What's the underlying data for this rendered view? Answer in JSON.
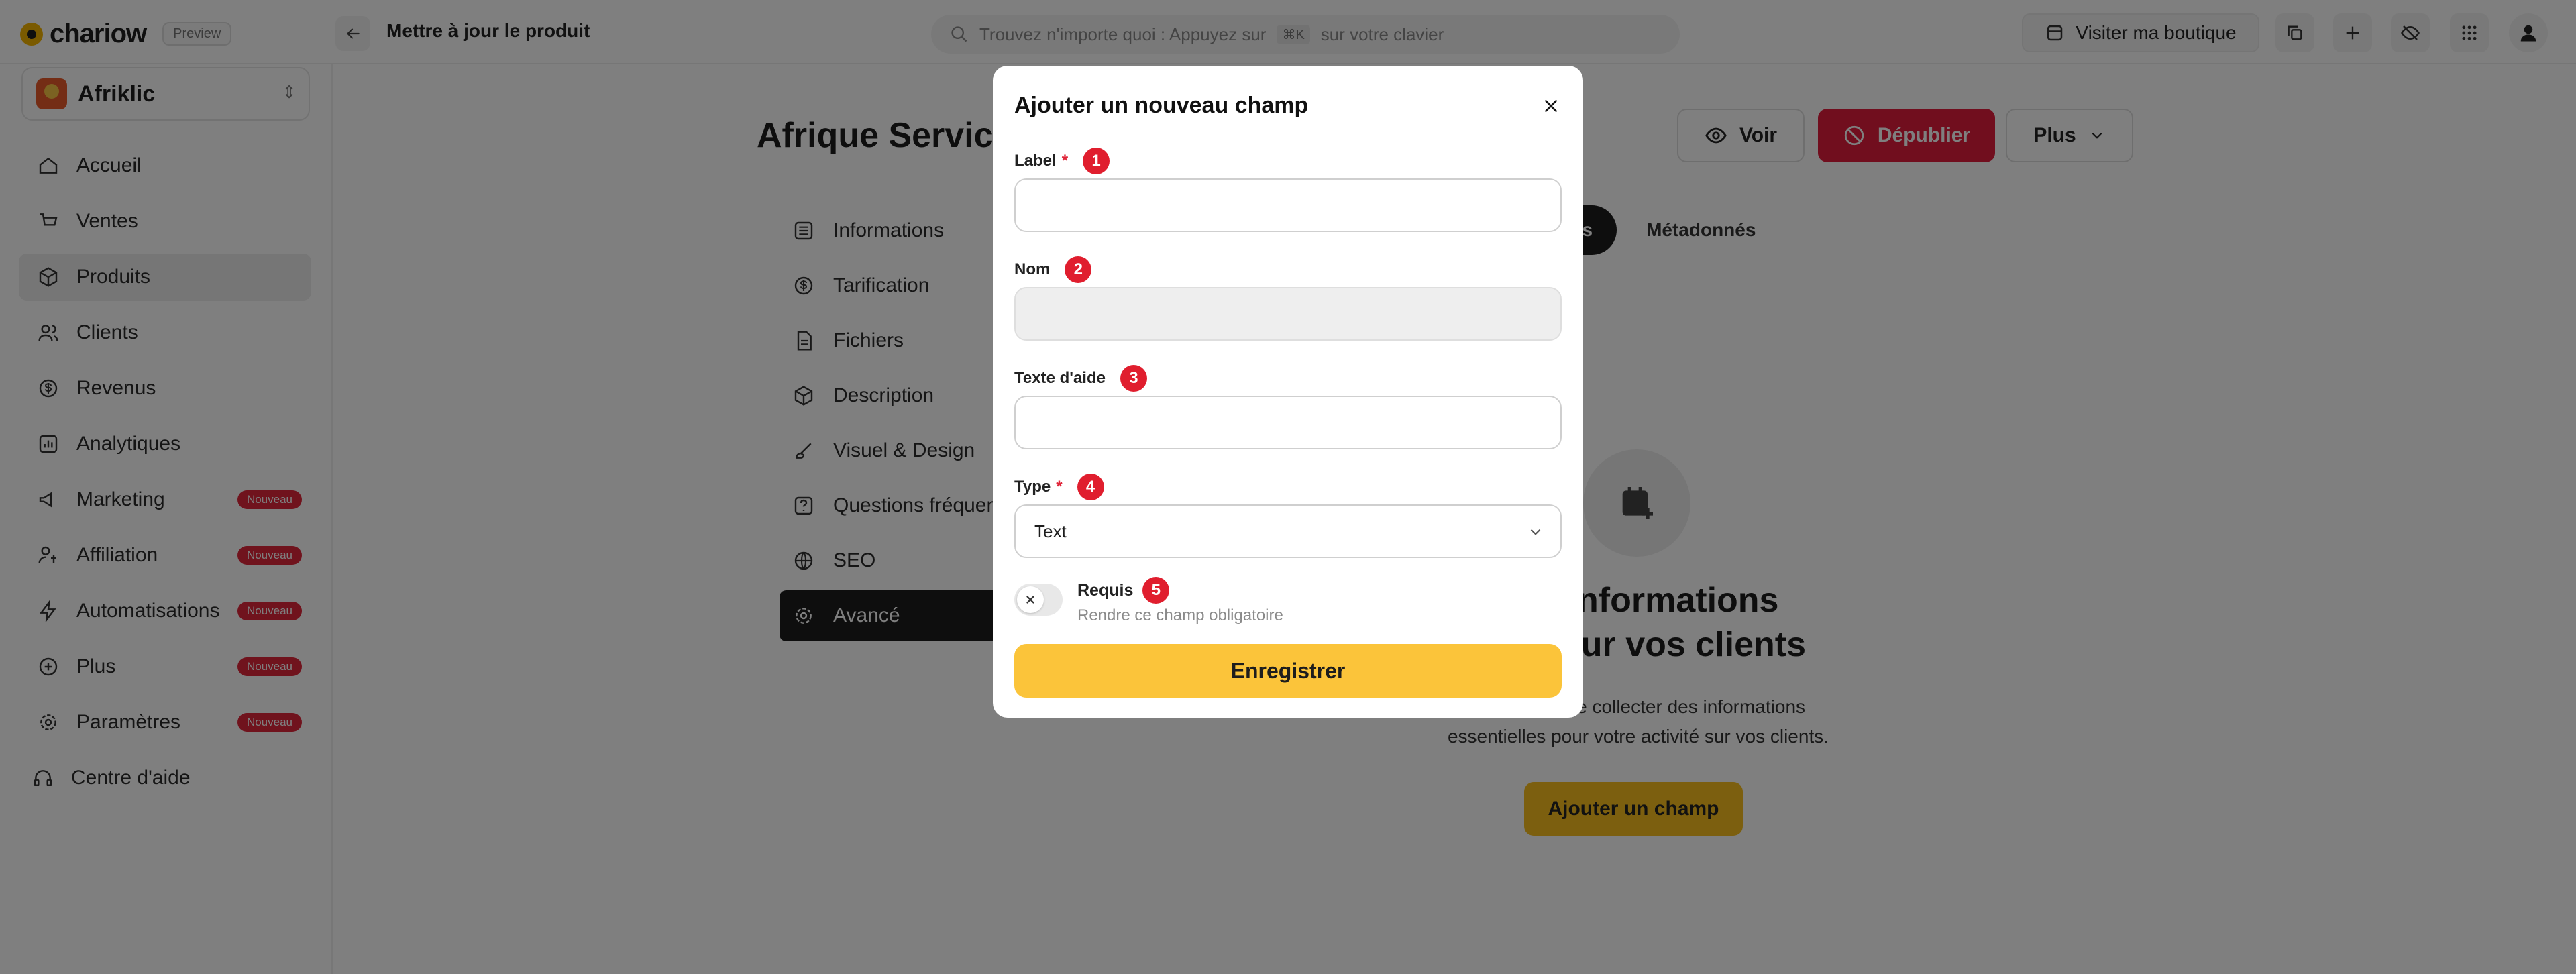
{
  "topbar": {
    "logo_text": "chariow",
    "preview_badge": "Preview",
    "page_heading": "Mettre à jour le produit",
    "search_placeholder": "Trouvez n'importe quoi : Appuyez sur",
    "search_shortcut": "⌘K",
    "search_suffix": "sur votre clavier",
    "visit_label": "Visiter ma boutique"
  },
  "sidebar": {
    "store_name": "Afriklic",
    "items": [
      {
        "label": "Accueil",
        "icon": "home-icon",
        "badge": ""
      },
      {
        "label": "Ventes",
        "icon": "cart-icon",
        "badge": ""
      },
      {
        "label": "Produits",
        "icon": "box-icon",
        "badge": "",
        "active": true
      },
      {
        "label": "Clients",
        "icon": "users-icon",
        "badge": ""
      },
      {
        "label": "Revenus",
        "icon": "money-icon",
        "badge": ""
      },
      {
        "label": "Analytiques",
        "icon": "chart-icon",
        "badge": ""
      },
      {
        "label": "Marketing",
        "icon": "megaphone-icon",
        "badge": "Nouveau"
      },
      {
        "label": "Affiliation",
        "icon": "affiliate-icon",
        "badge": "Nouveau"
      },
      {
        "label": "Automatisations",
        "icon": "bolt-icon",
        "badge": "Nouveau"
      },
      {
        "label": "Plus",
        "icon": "plus-circle-icon",
        "badge": "Nouveau"
      },
      {
        "label": "Paramètres",
        "icon": "gear-icon",
        "badge": "Nouveau"
      },
      {
        "label": "Centre d'aide",
        "icon": "headset-icon",
        "badge": ""
      }
    ]
  },
  "main": {
    "product_title": "Afrique Service",
    "voir_label": "Voir",
    "depublier_label": "Dépublier",
    "plus_label": "Plus",
    "submenu": [
      {
        "label": "Informations",
        "icon": "list-icon"
      },
      {
        "label": "Tarification",
        "icon": "dollar-icon"
      },
      {
        "label": "Fichiers",
        "icon": "file-icon"
      },
      {
        "label": "Description",
        "icon": "cube-icon"
      },
      {
        "label": "Visuel & Design",
        "icon": "brush-icon"
      },
      {
        "label": "Questions fréquen",
        "icon": "question-icon"
      },
      {
        "label": "SEO",
        "icon": "globe-icon"
      },
      {
        "label": "Avancé",
        "icon": "settings-icon",
        "active": true
      }
    ],
    "tabs": [
      "nnalisés",
      "Métadonnés"
    ],
    "empty_title_line1": "des informations",
    "empty_title_line2": "aires sur vos clients",
    "empty_desc": "permettent de collecter des informations essentielles pour votre activité sur vos clients.",
    "empty_cta": "Ajouter un champ"
  },
  "modal": {
    "title": "Ajouter un nouveau champ",
    "fields": {
      "label": {
        "label": "Label",
        "required": "*",
        "marker": "1",
        "value": ""
      },
      "nom": {
        "label": "Nom",
        "marker": "2",
        "value": ""
      },
      "help": {
        "label": "Texte d'aide",
        "marker": "3",
        "value": ""
      },
      "type": {
        "label": "Type",
        "required": "*",
        "marker": "4",
        "value": "Text"
      }
    },
    "requis": {
      "title": "Requis",
      "marker": "5",
      "subtitle": "Rendre ce champ obligatoire",
      "checked": false
    },
    "submit_label": "Enregistrer"
  },
  "colors": {
    "brand_yellow": "#fbc43a",
    "danger_red": "#e31c3d",
    "marker_red": "#e01e2e",
    "dark": "#1d1d1d"
  }
}
